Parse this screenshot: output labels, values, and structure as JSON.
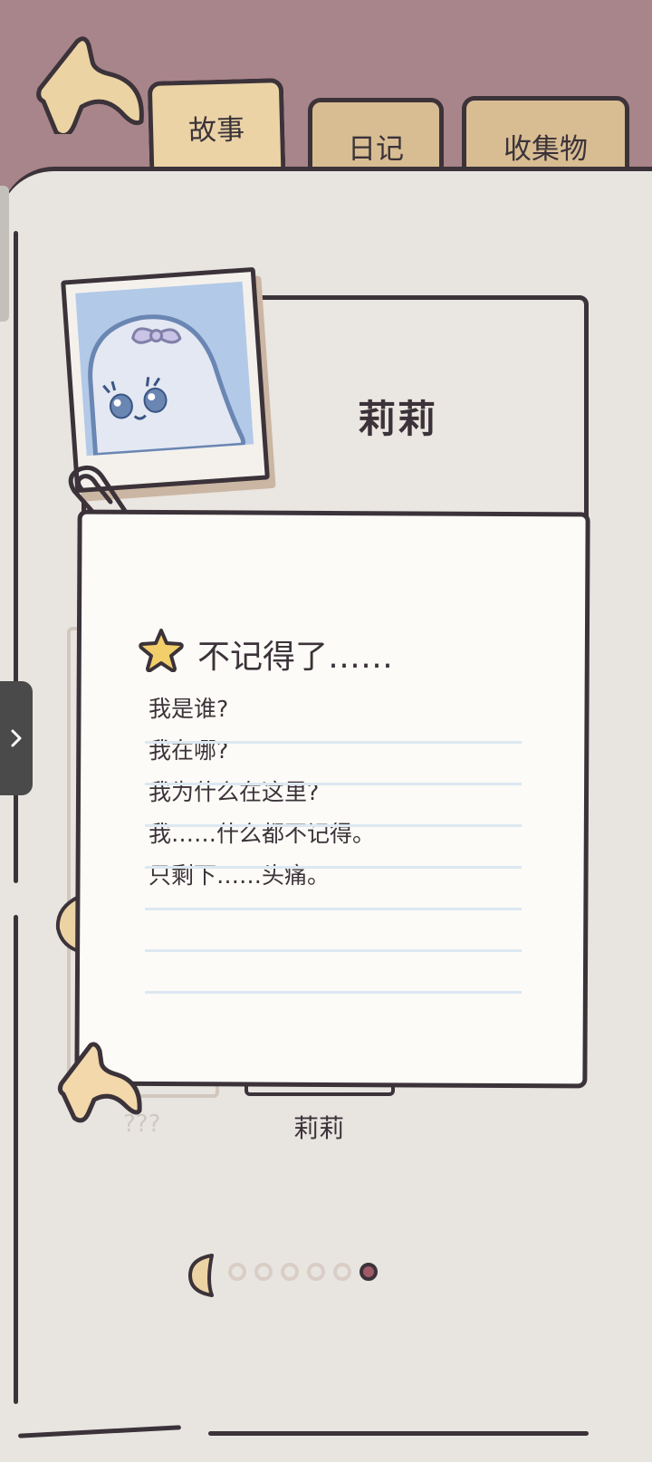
{
  "tabs": [
    {
      "label": "故事",
      "active": true
    },
    {
      "label": "日记",
      "active": false
    },
    {
      "label": "收集物",
      "active": false
    }
  ],
  "profile": {
    "name": "莉莉"
  },
  "note": {
    "title": "不记得了……",
    "lines": [
      "我是谁?",
      "我在哪?",
      "我为什么在这里?",
      "我……什么都不记得。",
      "只剩下……头痛。"
    ]
  },
  "gallery": {
    "unknown_label": "???",
    "selected_label": "莉莉"
  },
  "pagination": {
    "total": 6,
    "current": 6
  },
  "colors": {
    "background": "#a8858a",
    "paper": "#e8e5e0",
    "card": "#fdfbf7",
    "tab": "#d8bd93",
    "tab_active": "#ebd3a6",
    "ink": "#3b3339",
    "photo_bg": "#b3c9e8",
    "dot_active": "#a05a66"
  },
  "icons": {
    "back": "curved-arrow-back-icon",
    "star": "star-icon",
    "side": "chevron-right-icon"
  }
}
